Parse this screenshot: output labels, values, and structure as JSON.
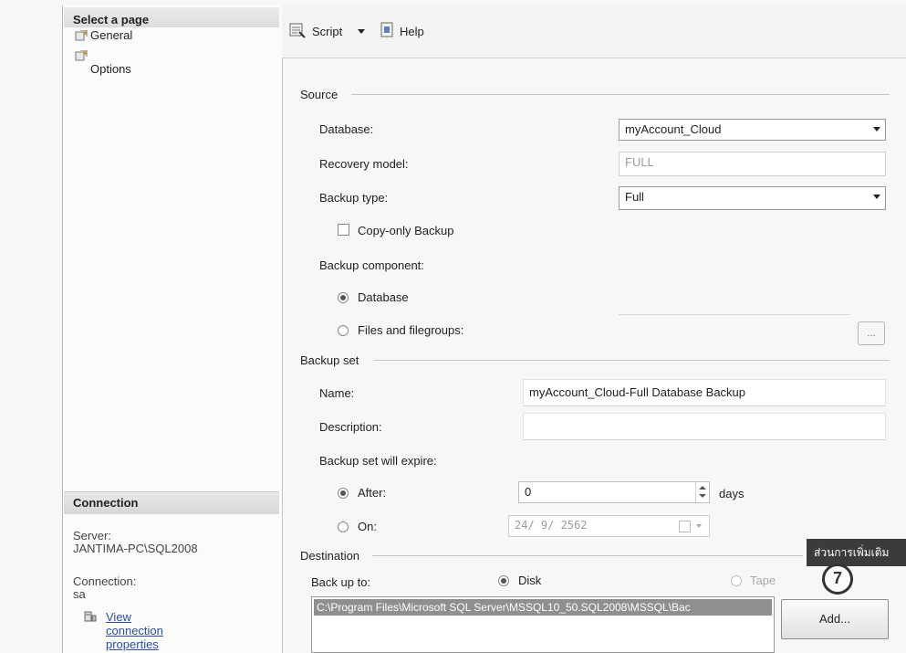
{
  "left": {
    "select_page_title": "Select a page",
    "pages": [
      {
        "label": "General",
        "icon": "page-icon"
      },
      {
        "label": "Options",
        "icon": "page-icon"
      }
    ],
    "connection_title": "Connection",
    "server_label": "Server:",
    "server_value": "JANTIMA-PC\\SQL2008",
    "connection_label": "Connection:",
    "connection_value": "sa",
    "view_props_link": "View connection properties"
  },
  "toolbar": {
    "script_label": "Script",
    "help_label": "Help"
  },
  "source": {
    "section_title": "Source",
    "database_label": "Database:",
    "database_value": "myAccount_Cloud",
    "recovery_label": "Recovery model:",
    "recovery_value": "FULL",
    "backup_type_label": "Backup type:",
    "backup_type_value": "Full",
    "copy_only_label": "Copy-only Backup",
    "copy_only_checked": false,
    "component_label": "Backup component:",
    "component_database_label": "Database",
    "component_files_label": "Files and filegroups:",
    "browse_label": "...",
    "selected_component": "Database"
  },
  "backup_set": {
    "section_title": "Backup set",
    "name_label": "Name:",
    "name_value": "myAccount_Cloud-Full Database Backup",
    "description_label": "Description:",
    "description_value": "",
    "expire_label": "Backup set will expire:",
    "after_label": "After:",
    "after_value": "0",
    "days_label": "days",
    "on_label": "On:",
    "on_value": "24/  9/  2562",
    "selected_expire": "After"
  },
  "destination": {
    "section_title": "Destination",
    "backup_to_label": "Back up to:",
    "disk_label": "Disk",
    "tape_label": "Tape",
    "selected": "Disk",
    "path_value": "C:\\Program Files\\Microsoft SQL Server\\MSSQL10_50.SQL2008\\MSSQL\\Bac",
    "add_label": "Add...",
    "tooltip_text": "ส่วนการเพิ่มเติม",
    "step_number": "7"
  }
}
